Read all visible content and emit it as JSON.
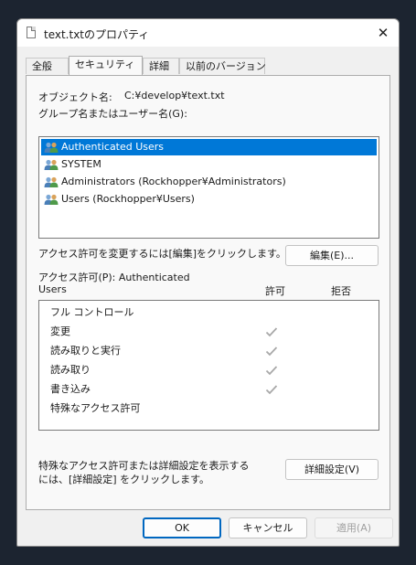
{
  "window": {
    "title": "text.txtのプロパティ",
    "close_glyph": "✕"
  },
  "tabs": [
    {
      "label": "全般",
      "active": false
    },
    {
      "label": "セキュリティ",
      "active": true
    },
    {
      "label": "詳細",
      "active": false
    },
    {
      "label": "以前のバージョン",
      "active": false
    }
  ],
  "security": {
    "object_name_label": "オブジェクト名:",
    "object_name_value": "C:¥develop¥text.txt",
    "group_label": "グループ名またはユーザー名(G):",
    "users": [
      {
        "name": "Authenticated Users",
        "selected": true,
        "icon": "users-group-icon"
      },
      {
        "name": "SYSTEM",
        "selected": false,
        "icon": "users-group-icon"
      },
      {
        "name": "Administrators (Rockhopper¥Administrators)",
        "selected": false,
        "icon": "users-group-icon"
      },
      {
        "name": "Users (Rockhopper¥Users)",
        "selected": false,
        "icon": "users-group-icon"
      }
    ],
    "change_perm_text": "アクセス許可を変更するには[編集]をクリックします。",
    "edit_button": "編集(E)...",
    "perm_for_label_line1": "アクセス許可(P): Authenticated",
    "perm_for_label_line2": "Users",
    "col_allow": "許可",
    "col_deny": "拒否",
    "permissions": [
      {
        "name": "フル コントロール",
        "allow": false,
        "deny": false
      },
      {
        "name": "変更",
        "allow": true,
        "deny": false
      },
      {
        "name": "読み取りと実行",
        "allow": true,
        "deny": false
      },
      {
        "name": "読み取り",
        "allow": true,
        "deny": false
      },
      {
        "name": "書き込み",
        "allow": true,
        "deny": false
      },
      {
        "name": "特殊なアクセス許可",
        "allow": false,
        "deny": false
      }
    ],
    "advanced_text_line1": "特殊なアクセス許可または詳細設定を表示する",
    "advanced_text_line2": "には、[詳細設定] をクリックします。",
    "advanced_button": "詳細設定(V)"
  },
  "footer": {
    "ok": "OK",
    "cancel": "キャンセル",
    "apply": "適用(A)"
  },
  "colors": {
    "selection": "#0078d7",
    "check_gray": "#a8a8a8",
    "default_button_border": "#0067c0"
  }
}
